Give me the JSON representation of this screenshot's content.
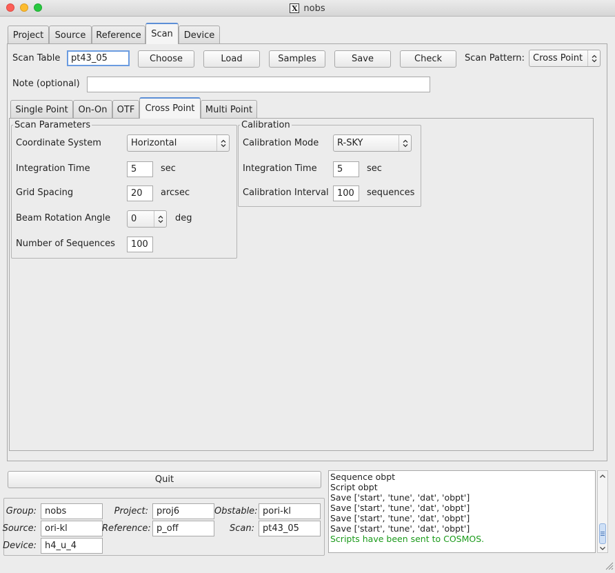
{
  "window": {
    "title": "nobs"
  },
  "main_tabs": [
    {
      "label": "Project"
    },
    {
      "label": "Source"
    },
    {
      "label": "Reference"
    },
    {
      "label": "Scan"
    },
    {
      "label": "Device"
    }
  ],
  "scan_table": {
    "label": "Scan Table",
    "value": "pt43_05",
    "choose_label": "Choose",
    "load_label": "Load",
    "samples_label": "Samples",
    "save_label": "Save",
    "check_label": "Check",
    "pattern_label": "Scan Pattern:",
    "pattern_value": "Cross Point"
  },
  "note": {
    "label": "Note (optional)",
    "value": ""
  },
  "pattern_tabs": [
    {
      "label": "Single Point"
    },
    {
      "label": "On-On"
    },
    {
      "label": "OTF"
    },
    {
      "label": "Cross Point"
    },
    {
      "label": "Multi Point"
    }
  ],
  "scan_params": {
    "title": "Scan Parameters",
    "coord_label": "Coordinate System",
    "coord_value": "Horizontal",
    "int_label": "Integration Time",
    "int_value": "5",
    "int_unit": "sec",
    "grid_label": "Grid Spacing",
    "grid_value": "20",
    "grid_unit": "arcsec",
    "beam_label": "Beam Rotation Angle",
    "beam_value": "0",
    "beam_unit": "deg",
    "seq_label": "Number of Sequences",
    "seq_value": "100"
  },
  "calibration": {
    "title": "Calibration",
    "mode_label": "Calibration Mode",
    "mode_value": "R-SKY",
    "int_label": "Integration Time",
    "int_value": "5",
    "int_unit": "sec",
    "interval_label": "Calibration Interval",
    "interval_value": "100",
    "interval_unit": "sequences"
  },
  "quit_label": "Quit",
  "summary": {
    "group_label": "Group:",
    "group_value": "nobs",
    "project_label": "Project:",
    "project_value": "proj6",
    "obstable_label": "Obstable:",
    "obstable_value": "pori-kl",
    "source_label": "Source:",
    "source_value": "ori-kl",
    "reference_label": "Reference:",
    "reference_value": "p_off",
    "scan_label": "Scan:",
    "scan_value": "pt43_05",
    "device_label": "Device:",
    "device_value": "h4_u_4"
  },
  "log": {
    "lines": [
      "Sequence obpt",
      "Script obpt",
      "Save ['start', 'tune', 'dat', 'obpt']",
      "Save ['start', 'tune', 'dat', 'obpt']",
      "Save ['start', 'tune', 'dat', 'obpt']",
      "Save ['start', 'tune', 'dat', 'obpt']"
    ],
    "status": "Scripts have been sent to COSMOS.",
    "status_color": "#1a9a1a"
  },
  "colors": {
    "accent": "#5b8ed6",
    "background": "#ececec"
  }
}
